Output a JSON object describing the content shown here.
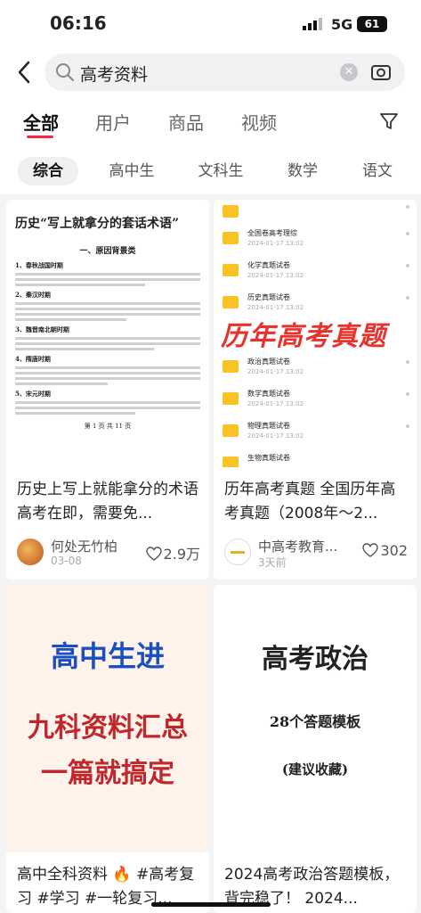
{
  "status": {
    "time": "06:16",
    "network": "5G",
    "battery": "61"
  },
  "search": {
    "query": "高考资料"
  },
  "tabs": [
    "全部",
    "用户",
    "商品",
    "视频"
  ],
  "chips": [
    "综合",
    "高中生",
    "文科生",
    "数学",
    "语文"
  ],
  "cards": [
    {
      "doc": {
        "title": "历史“写上就拿分的套话术语”",
        "subtitle": "一、原因背景类",
        "sections": [
          "1、春秋战国时期",
          "2、秦汉时期",
          "3、魏晋南北朝时期",
          "4、隋唐时期",
          "5、宋元时期"
        ],
        "footer": "第 1 页 共 11 页"
      },
      "title": "历史上写上就能拿分的术语 高考在即，需要免...",
      "author": "何处无竹柏",
      "date": "03-08",
      "likes": "2.9万"
    },
    {
      "folders": [
        {
          "name": "全国卷高考理综",
          "date": "2024-01-17 13:02"
        },
        {
          "name": "化学真题试卷",
          "date": "2024-01-17 13:02"
        },
        {
          "name": "历史真题试卷",
          "date": "2024-01-17 13:02"
        },
        {
          "name": "政治真题试卷",
          "date": "2024-01-17 13:02"
        },
        {
          "name": "数学真题试卷",
          "date": "2024-01-17 13:02"
        },
        {
          "name": "物理真题试卷",
          "date": "2024-01-17 13:02"
        },
        {
          "name": "生物真题试卷",
          "date": ""
        }
      ],
      "overlay": "历年高考真题",
      "title": "历年高考真题 全国历年高考真题（2008年～2...",
      "author": "中高考教育...",
      "date": "3天前",
      "likes": "302"
    },
    {
      "poster": [
        "高中生进",
        "九科资料汇总",
        "一篇就搞定"
      ],
      "title": "高中全科资料 🔥 #高考复习 #学习 #一轮复习..."
    },
    {
      "poster": [
        "高考政治",
        "28个答题模板",
        "(建议收藏)"
      ],
      "title": "2024高考政治答题模板，背完稳了！ 2024..."
    }
  ],
  "colors": {
    "accent": "#ff2442",
    "folder": "#f7c325"
  }
}
